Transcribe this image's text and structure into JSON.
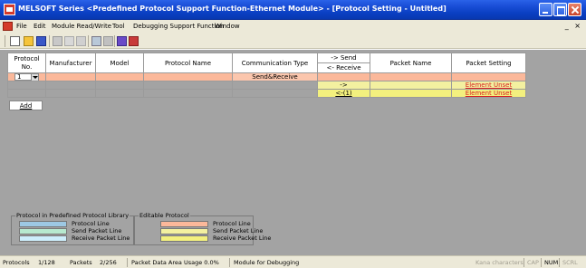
{
  "window": {
    "title": "MELSOFT Series <Predefined Protocol Support Function-Ethernet Module> - [Protocol Setting - Untitled]"
  },
  "menu": {
    "items": [
      "File",
      "Edit",
      "Module Read/Write",
      "Tool",
      "Debugging Support Function",
      "Window"
    ],
    "mdi_controls": "_ ×"
  },
  "grid": {
    "headers": {
      "protocol_no": "Protocol No.",
      "manufacturer": "Manufacturer",
      "model": "Model",
      "protocol_name": "Protocol Name",
      "communication_type": "Communication Type",
      "send": "-> Send",
      "receive": "<- Receive",
      "packet_name": "Packet Name",
      "packet_setting": "Packet Setting"
    },
    "rows": [
      {
        "protocol_no": "1",
        "manufacturer": "",
        "model": "",
        "protocol_name": "",
        "communication_type": "Send&Receive",
        "direction": "",
        "packet_name": "",
        "packet_setting": ""
      },
      {
        "direction": "->",
        "packet_name": "",
        "packet_setting": "Element Unset"
      },
      {
        "direction": "<-(1)",
        "packet_name": "",
        "packet_setting": "Element Unset"
      }
    ],
    "add_label": "Add"
  },
  "legend": {
    "library": {
      "title": "Protocol in Predefined Protocol Library",
      "items": [
        {
          "label": "Protocol Line",
          "color": "#9dc8e3"
        },
        {
          "label": "Send Packet Line",
          "color": "#b7e9cf"
        },
        {
          "label": "Receive Packet Line",
          "color": "#cdeefc"
        }
      ]
    },
    "editable": {
      "title": "Editable Protocol",
      "items": [
        {
          "label": "Protocol Line",
          "color": "#fbb89a"
        },
        {
          "label": "Send Packet Line",
          "color": "#f3f0a0"
        },
        {
          "label": "Receive Packet Line",
          "color": "#f3f07e"
        }
      ]
    }
  },
  "status": {
    "protocols_label": "Protocols",
    "protocols_value": "1/128",
    "packets_label": "Packets",
    "packets_value": "2/256",
    "usage": "Packet Data Area Usage   0.0%",
    "mode": "Module for Debugging",
    "kana": "Kana characters",
    "cap": "CAP",
    "num": "NUM",
    "scrl": "SCRL"
  }
}
